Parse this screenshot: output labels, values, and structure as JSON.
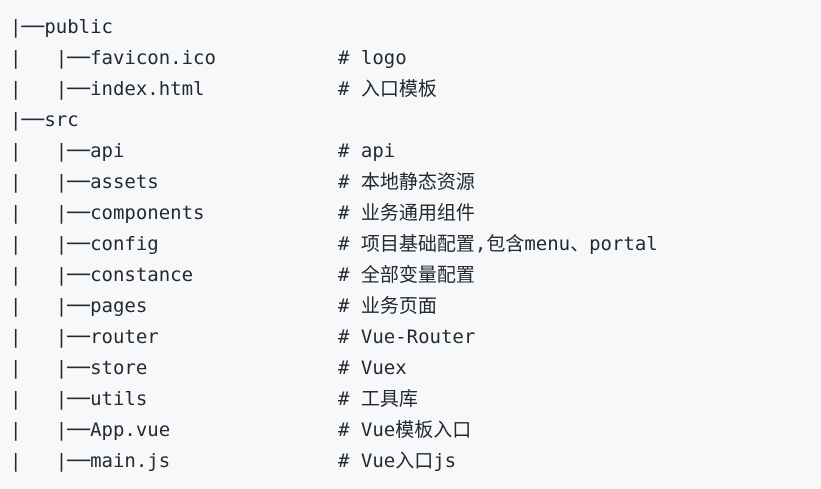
{
  "lines": [
    {
      "tree": "|──public",
      "comment": ""
    },
    {
      "tree": "|   |──favicon.ico",
      "comment": "# logo"
    },
    {
      "tree": "|   |──index.html",
      "comment": "# 入口模板"
    },
    {
      "tree": "|──src",
      "comment": ""
    },
    {
      "tree": "|   |──api",
      "comment": "# api"
    },
    {
      "tree": "|   |──assets",
      "comment": "# 本地静态资源"
    },
    {
      "tree": "|   |──components",
      "comment": "# 业务通用组件"
    },
    {
      "tree": "|   |──config",
      "comment": "# 项目基础配置,包含menu、portal"
    },
    {
      "tree": "|   |──constance",
      "comment": "# 全部变量配置"
    },
    {
      "tree": "|   |──pages",
      "comment": "# 业务页面"
    },
    {
      "tree": "|   |──router",
      "comment": "# Vue-Router"
    },
    {
      "tree": "|   |──store",
      "comment": "# Vuex"
    },
    {
      "tree": "|   |──utils",
      "comment": "# 工具库"
    },
    {
      "tree": "|   |──App.vue",
      "comment": "# Vue模板入口"
    },
    {
      "tree": "|   |──main.js",
      "comment": "# Vue入口js"
    }
  ]
}
